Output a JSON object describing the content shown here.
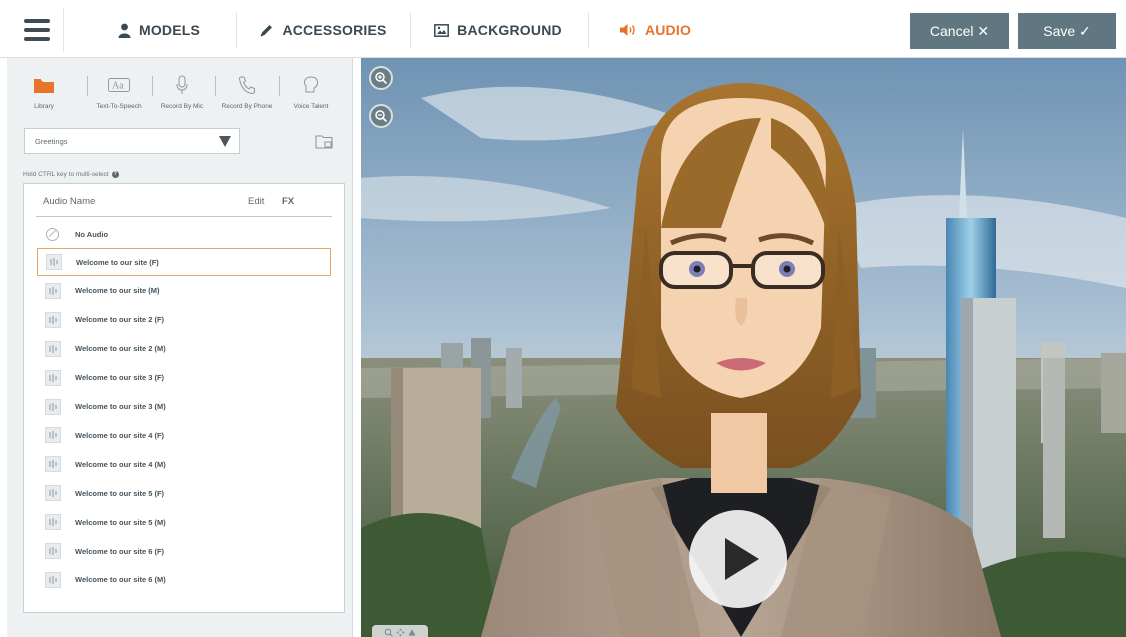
{
  "topbar": {
    "tabs": [
      {
        "label": "MODELS",
        "icon": "person-icon"
      },
      {
        "label": "ACCESSORIES",
        "icon": "pencil-icon"
      },
      {
        "label": "BACKGROUND",
        "icon": "image-icon"
      },
      {
        "label": "AUDIO",
        "icon": "speaker-icon",
        "active": true
      }
    ],
    "cancel_label": "Cancel ✕",
    "save_label": "Save ✓",
    "accent_color": "#e8732a",
    "button_color": "#607782"
  },
  "audio_panel": {
    "source_tabs": [
      {
        "label": "Library",
        "icon": "folder-icon",
        "active": true
      },
      {
        "label": "Text-To-Speech",
        "icon": "text-icon"
      },
      {
        "label": "Record By Mic",
        "icon": "microphone-icon"
      },
      {
        "label": "Record By Phone",
        "icon": "phone-icon"
      },
      {
        "label": "Voice Talent",
        "icon": "voice-talent-icon"
      }
    ],
    "category_select": "Greetings",
    "hint": "Hold CTRL key to multi-select",
    "columns": {
      "name": "Audio Name",
      "edit": "Edit",
      "fx": "FX"
    },
    "no_audio_label": "No Audio",
    "items": [
      {
        "name": "Welcome to our site (F)",
        "selected": true
      },
      {
        "name": "Welcome to our site (M)"
      },
      {
        "name": "Welcome to our site 2 (F)"
      },
      {
        "name": "Welcome to our site 2 (M)"
      },
      {
        "name": "Welcome to our site 3 (F)"
      },
      {
        "name": "Welcome to our site 3 (M)"
      },
      {
        "name": "Welcome to our site 4 (F)"
      },
      {
        "name": "Welcome to our site 4 (M)"
      },
      {
        "name": "Welcome to our site 5 (F)"
      },
      {
        "name": "Welcome to our site 5 (M)"
      },
      {
        "name": "Welcome to our site 6 (F)"
      },
      {
        "name": "Welcome to our site 6 (M)"
      }
    ]
  },
  "stage": {
    "zoom_controls": [
      "zoom-in-icon",
      "zoom-out-icon"
    ],
    "play_icon": "play-icon"
  }
}
